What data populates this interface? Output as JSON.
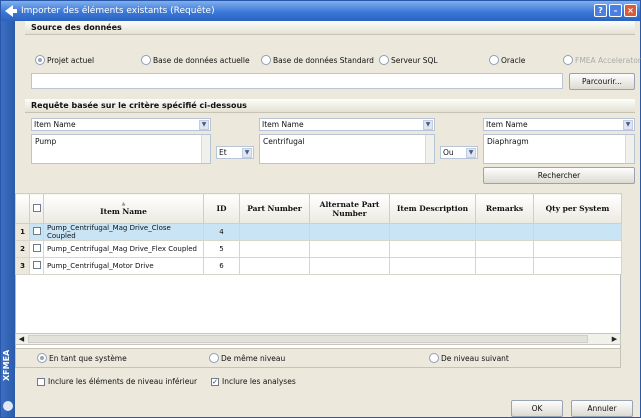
{
  "window": {
    "title": "Importer des éléments existants (Requête)",
    "help": "?",
    "minimize": "–",
    "close": "×"
  },
  "brand": "XFMEA",
  "source": {
    "heading": "Source des données",
    "options": [
      "Projet actuel",
      "Base de données actuelle",
      "Base de données Standard",
      "Serveur SQL",
      "Oracle",
      "FMEA Accelerator"
    ],
    "selected_index": 0,
    "path_value": "",
    "browse_label": "Parcourir..."
  },
  "query": {
    "heading": "Requête basée sur le critère spécifié ci-dessous",
    "criteria": [
      {
        "field": "Item Name",
        "value": "Pump"
      },
      {
        "field": "Item Name",
        "value": "Centrifugal"
      },
      {
        "field": "Item Name",
        "value": "Diaphragm"
      }
    ],
    "operators": [
      "Et",
      "Ou"
    ],
    "search_label": "Rechercher"
  },
  "grid": {
    "columns": [
      "Item Name",
      "ID",
      "Part Number",
      "Alternate Part Number",
      "Item Description",
      "Remarks",
      "Qty per System"
    ],
    "rows": [
      {
        "num": "1",
        "name": "Pump_Centrifugal_Mag Drive_Close Coupled",
        "id": "4"
      },
      {
        "num": "2",
        "name": "Pump_Centrifugal_Mag Drive_Flex Coupled",
        "id": "5"
      },
      {
        "num": "3",
        "name": "Pump_Centrifugal_Motor Drive",
        "id": "6"
      }
    ],
    "sort_indicator": "▲",
    "scroll_left": "◀",
    "scroll_right": "▶"
  },
  "import_mode": {
    "options": [
      "En tant que système",
      "De même niveau",
      "De niveau suivant"
    ],
    "selected_index": 0
  },
  "includes": [
    {
      "label": "Inclure les éléments de niveau inférieur",
      "checked": false
    },
    {
      "label": "Inclure les analyses",
      "checked": true
    }
  ],
  "footer": {
    "ok": "OK",
    "cancel": "Annuler"
  },
  "colors": {
    "title_bar": "#3c78d6",
    "selected_row": "#c9e4f5",
    "sidebar": "#2a5aaa"
  }
}
